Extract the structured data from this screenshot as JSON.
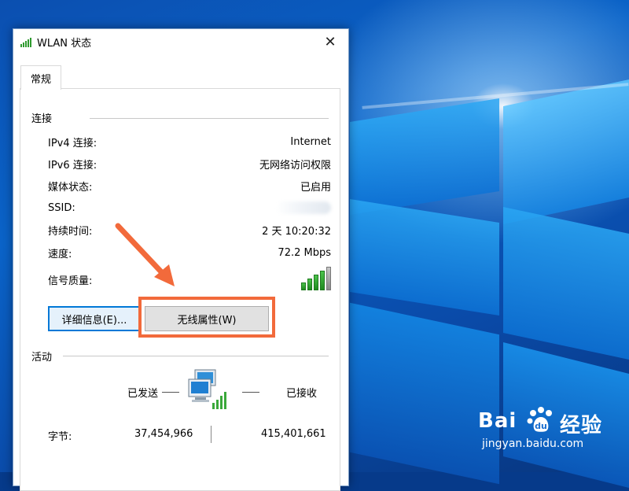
{
  "window": {
    "title": "WLAN 状态",
    "close_glyph": "✕"
  },
  "tabs": [
    {
      "label": "常规",
      "active": true
    }
  ],
  "connection": {
    "section_title": "连接",
    "rows": [
      {
        "label": "IPv4 连接:",
        "value": "Internet"
      },
      {
        "label": "IPv6 连接:",
        "value": "无网络访问权限"
      },
      {
        "label": "媒体状态:",
        "value": "已启用"
      },
      {
        "label": "SSID:",
        "value": ""
      },
      {
        "label": "持续时间:",
        "value": "2 天 10:20:32"
      },
      {
        "label": "速度:",
        "value": "72.2 Mbps"
      },
      {
        "label": "信号质量:",
        "signal_bars": 4,
        "signal_bars_total": 5,
        "icon": "signal-strength-icon"
      }
    ],
    "details_button": "详细信息(E)...",
    "wireless_props_button": "无线属性(W)"
  },
  "activity": {
    "section_title": "活动",
    "sent_label": "已发送",
    "received_label": "已接收",
    "network_icon": "network-computers-icon",
    "bytes_label": "字节:",
    "bytes_sent": "37,454,966",
    "bytes_received": "415,401,661"
  },
  "watermark": {
    "brand_left": "Bai",
    "brand_right": "经验",
    "url": "jingyan.baidu.com"
  },
  "colors": {
    "highlight": "#f26a3b",
    "accent": "#0078d7",
    "signal_green": "#2e9a2e"
  }
}
